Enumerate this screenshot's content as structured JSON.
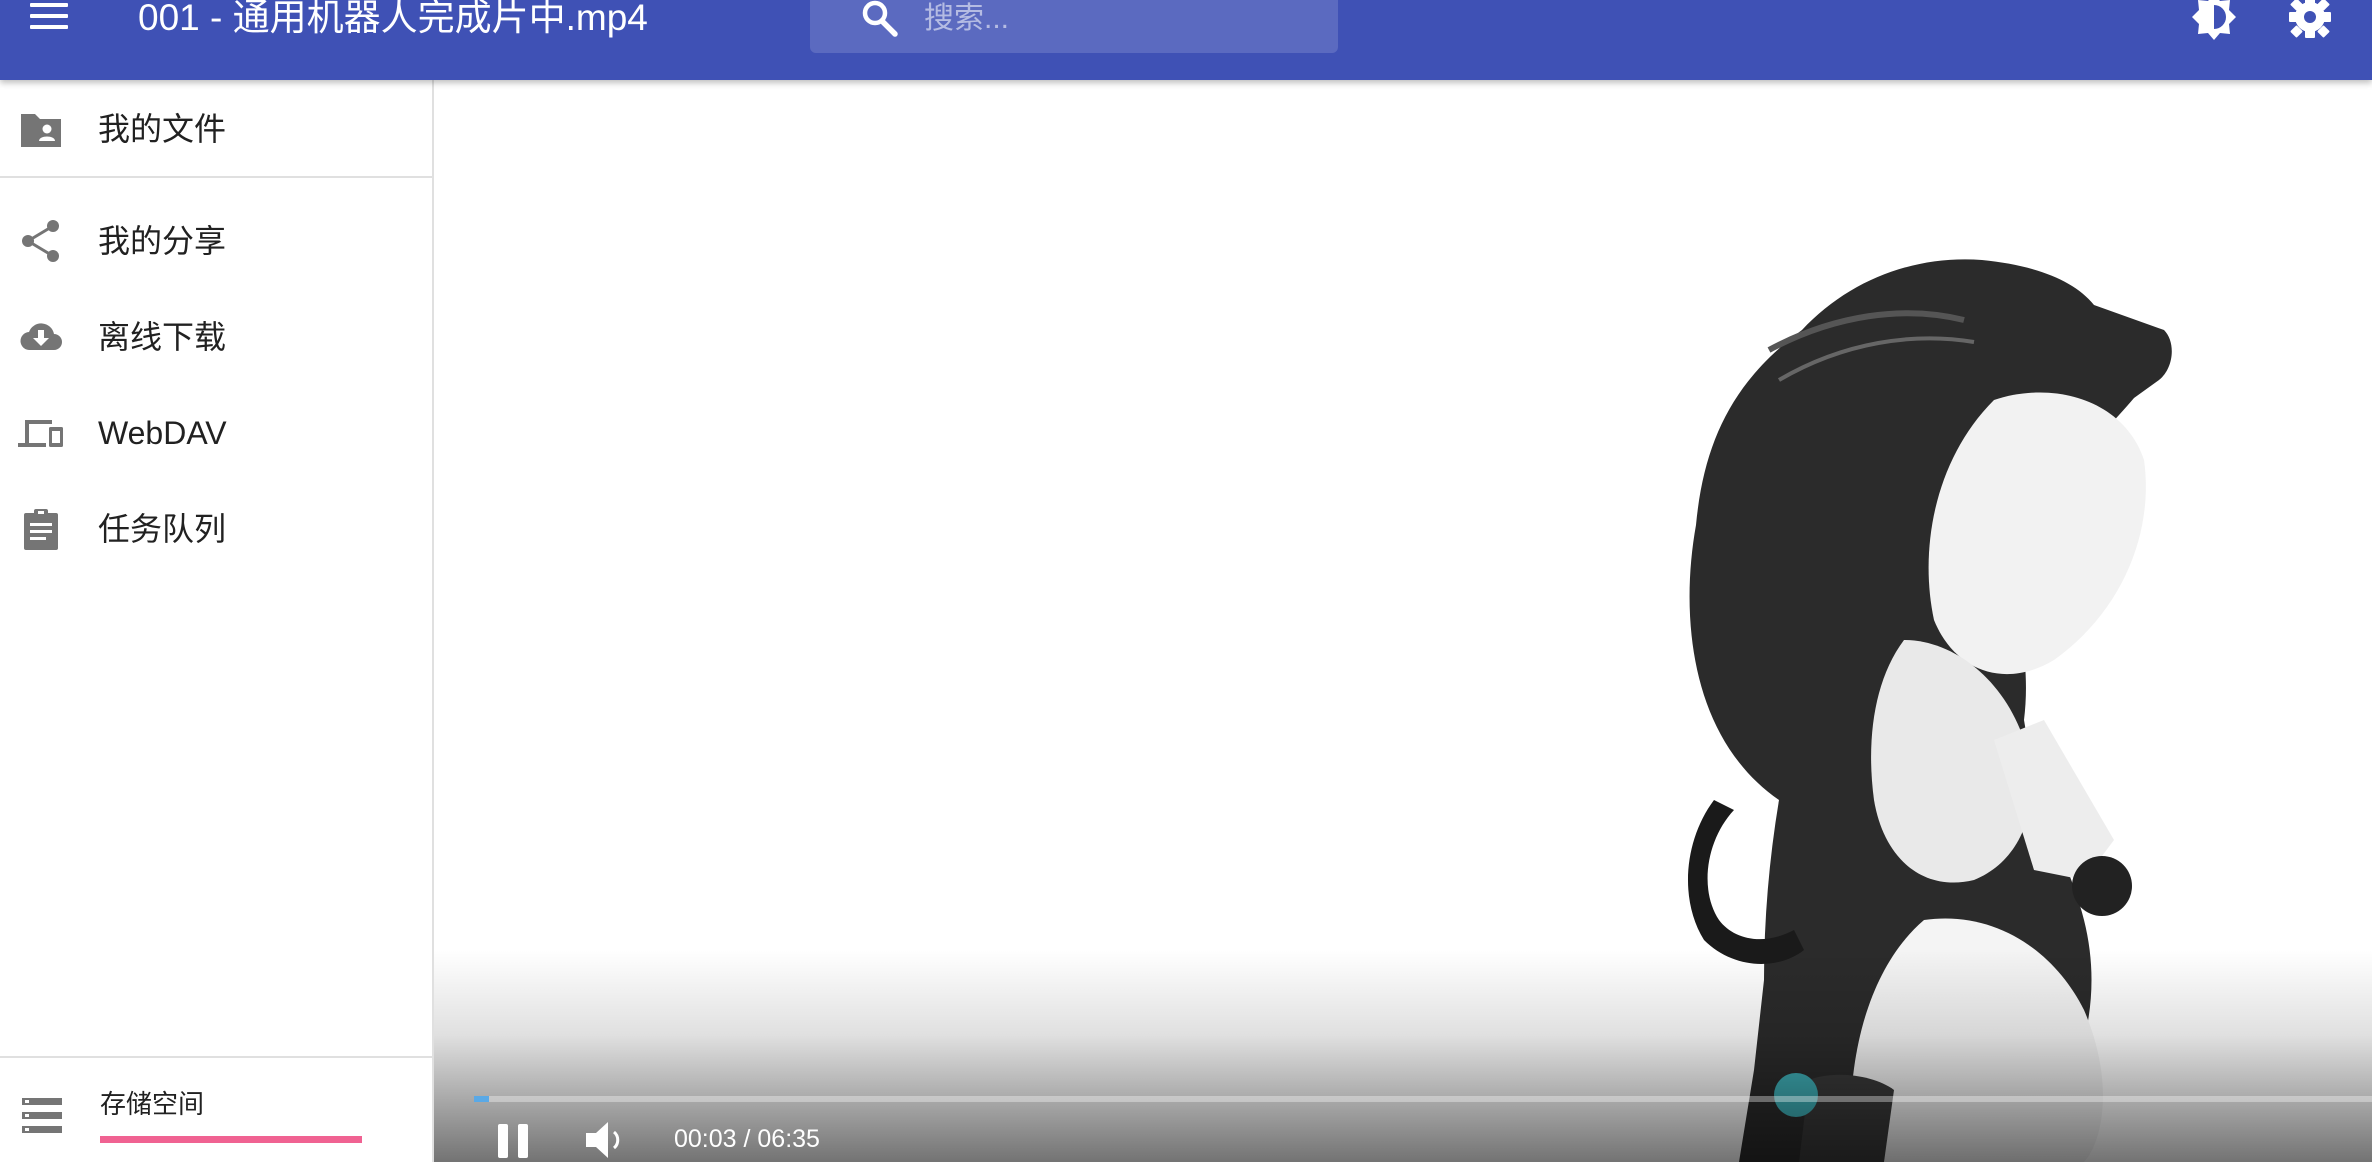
{
  "header": {
    "title": "001 - 通用机器人完成片中.mp4",
    "menu_icon": "menu-icon",
    "search_placeholder": "搜索...",
    "search_icon": "search-icon",
    "theme_icon": "brightness-icon",
    "settings_icon": "gear-icon",
    "bar_color": "#3f51b5"
  },
  "sidebar": {
    "items": [
      {
        "label": "我的文件",
        "icon": "folder-shared-icon"
      },
      {
        "label": "我的分享",
        "icon": "share-icon"
      },
      {
        "label": "离线下载",
        "icon": "cloud-download-icon"
      },
      {
        "label": "WebDAV",
        "icon": "devices-icon"
      },
      {
        "label": "任务队列",
        "icon": "clipboard-icon"
      }
    ],
    "storage": {
      "label": "存储空间",
      "icon": "storage-icon",
      "bar_color": "#f06292",
      "usage_fraction": 1.0
    }
  },
  "player": {
    "time": "00:03 / 06:35",
    "progress_fraction": 0.008,
    "pause_icon": "pause-icon",
    "volume_icon": "volume-icon"
  }
}
